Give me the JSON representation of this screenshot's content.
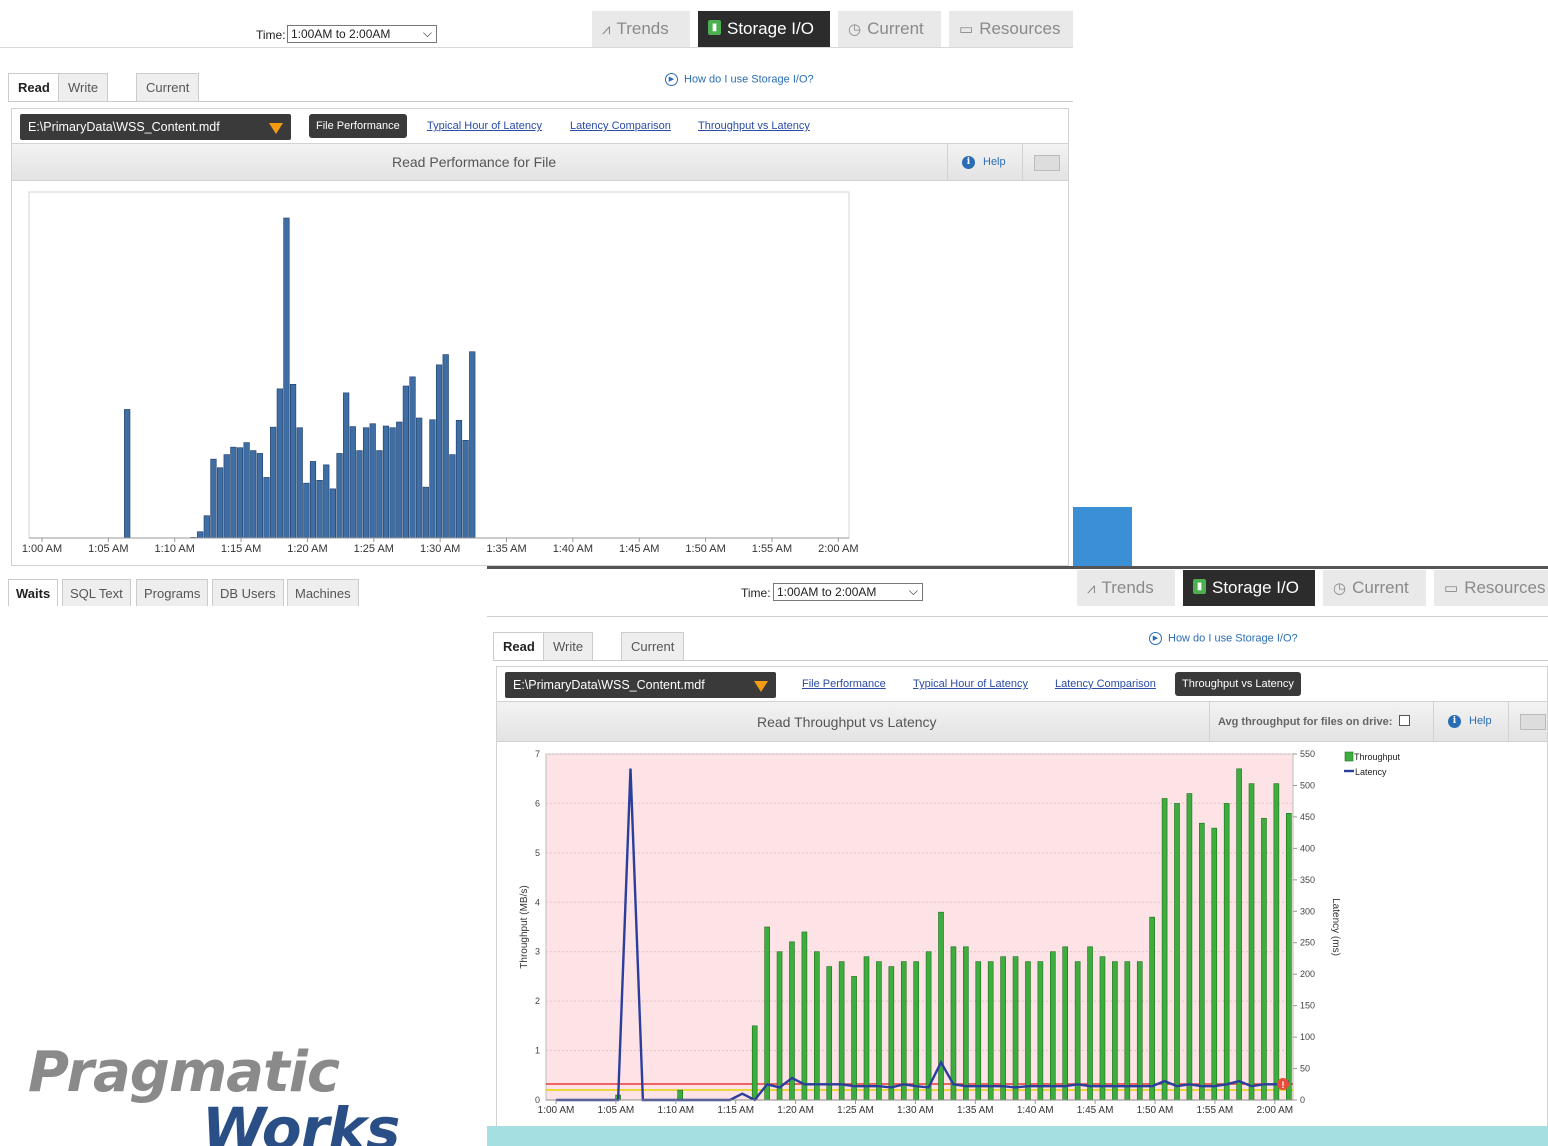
{
  "toolbar": {
    "time_label": "Time:",
    "time_value": "1:00AM to 2:00AM",
    "nav": [
      {
        "label": "Trends",
        "icon": "trend-line-icon"
      },
      {
        "label": "Storage I/O",
        "icon": "storage-icon"
      },
      {
        "label": "Current",
        "icon": "clock-icon"
      },
      {
        "label": "Resources",
        "icon": "monitor-icon"
      }
    ]
  },
  "tabs": [
    "Read",
    "Write",
    "Current"
  ],
  "help_link": "How do I use Storage I/O?",
  "file_select": "E:\\PrimaryData\\WSS_Content.mdf",
  "subnav": [
    "File Performance",
    "Typical Hour of Latency",
    "Latency Comparison",
    "Throughput vs Latency"
  ],
  "help_label": "Help",
  "panel1": {
    "title": "Read Performance for File"
  },
  "panel2": {
    "title": "Read Throughput vs Latency",
    "avg_label": "Avg throughput for files on drive:"
  },
  "bottom_tabs": [
    "Waits",
    "SQL Text",
    "Programs",
    "DB Users",
    "Machines"
  ],
  "logo": {
    "line1": "Pragmatic",
    "line2": "Works"
  },
  "colors": {
    "bar_blue": "#3f6ea5",
    "bar_green": "#3dae3d",
    "latency_line": "#2c3e9c",
    "pink_bg": "#fde3e6",
    "nav_active": "#2c2c2c",
    "accent_orange": "#f39c12"
  },
  "chart_data": [
    {
      "type": "bar",
      "title": "Read Performance for File",
      "x_tick_labels": [
        "1:00 AM",
        "1:05 AM",
        "1:10 AM",
        "1:15 AM",
        "1:20 AM",
        "1:25 AM",
        "1:30 AM",
        "1:35 AM",
        "1:40 AM",
        "1:45 AM",
        "1:50 AM",
        "1:55 AM",
        "2:00 AM"
      ],
      "y_axis_labels_shown": false,
      "values": [
        0,
        0,
        0,
        0,
        0,
        22.5,
        0,
        0,
        0,
        0,
        0,
        0,
        0,
        0,
        0,
        0.1,
        1.1,
        3.9,
        13.8,
        12.3,
        14.6,
        15.9,
        15.8,
        16.7,
        15.3,
        14.8,
        10.6,
        19.4,
        26.1,
        56.0,
        26.9,
        19.3,
        9.6,
        13.4,
        10.1,
        12.8,
        8.6,
        14.8,
        25.4,
        19.5,
        15.3,
        19.3,
        20.0,
        15.3,
        19.6,
        19.3,
        20.3,
        26.6,
        28.2,
        21.0,
        8.9,
        20.7,
        30.3,
        32.1,
        14.6,
        20.6,
        17.1,
        32.6
      ]
    },
    {
      "type": "bar",
      "title": "Read Throughput vs Latency",
      "ylabel": "Throughput (MB/s)",
      "y2label": "Latency (ms)",
      "ylim": [
        0,
        7
      ],
      "y2lim": [
        0,
        550
      ],
      "y_ticks": [
        "0",
        "1",
        "2",
        "3",
        "4",
        "5",
        "6",
        "7"
      ],
      "y2_ticks": [
        "0",
        "50",
        "100",
        "150",
        "200",
        "250",
        "300",
        "350",
        "400",
        "450",
        "500",
        "550"
      ],
      "x_tick_labels": [
        "1:00 AM",
        "1:05 AM",
        "1:10 AM",
        "1:15 AM",
        "1:20 AM",
        "1:25 AM",
        "1:30 AM",
        "1:35 AM",
        "1:40 AM",
        "1:45 AM",
        "1:50 AM",
        "1:55 AM",
        "2:00 AM"
      ],
      "legend": [
        "Throughput",
        "Latency"
      ],
      "series": [
        {
          "name": "Throughput",
          "values": [
            0,
            0,
            0,
            0,
            0,
            0.1,
            0,
            0,
            0,
            0,
            0.2,
            0,
            0,
            0,
            0,
            0,
            1.5,
            3.5,
            3.0,
            3.2,
            3.4,
            3.0,
            2.7,
            2.8,
            2.5,
            2.9,
            2.8,
            2.7,
            2.8,
            2.8,
            3.0,
            3.8,
            3.1,
            3.1,
            2.8,
            2.8,
            2.9,
            2.9,
            2.8,
            2.8,
            3.0,
            3.1,
            2.8,
            3.1,
            2.9,
            2.8,
            2.8,
            2.8,
            3.7,
            6.1,
            6.0,
            6.2,
            5.6,
            5.5,
            6.0,
            6.7,
            6.4,
            5.7,
            6.4,
            5.8
          ]
        },
        {
          "name": "Latency",
          "values": [
            0,
            0,
            0,
            0,
            0,
            0,
            527,
            0,
            0,
            0,
            0,
            0,
            0,
            0,
            0,
            10,
            0,
            25,
            20,
            35,
            25,
            25,
            25,
            25,
            22,
            22,
            22,
            20,
            25,
            22,
            20,
            60,
            25,
            22,
            22,
            22,
            22,
            20,
            22,
            22,
            22,
            22,
            25,
            22,
            22,
            22,
            22,
            22,
            22,
            30,
            22,
            25,
            22,
            22,
            25,
            30,
            22,
            25,
            25,
            30
          ]
        }
      ]
    }
  ]
}
